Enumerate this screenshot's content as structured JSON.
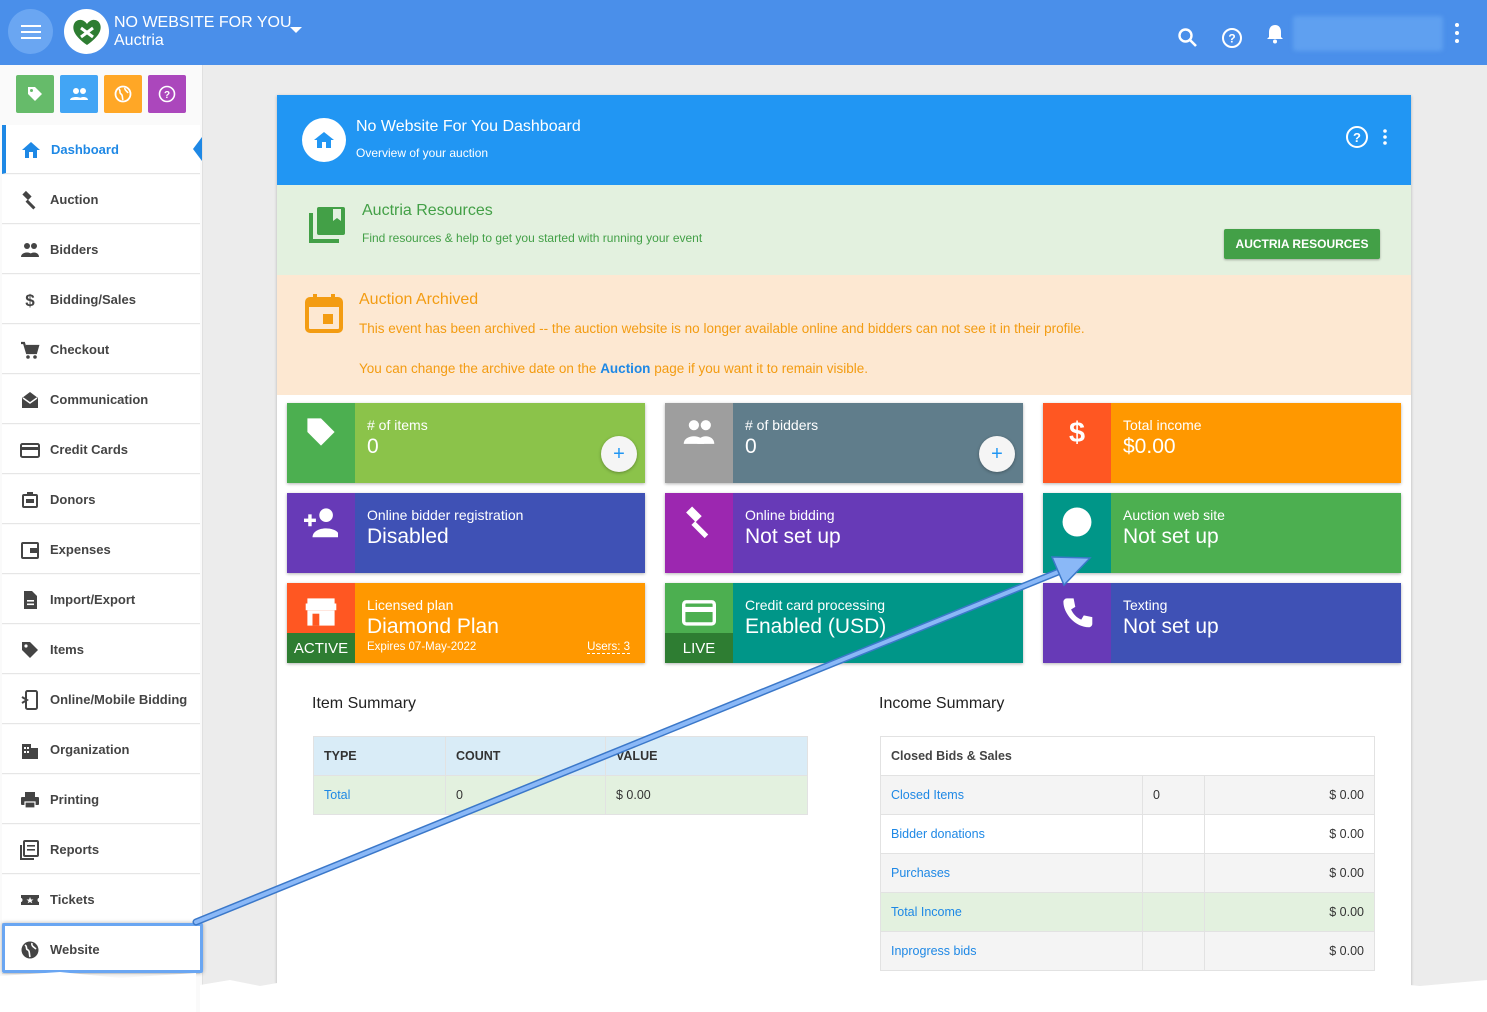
{
  "header": {
    "org_name": "NO WEBSITE FOR YOU",
    "org_sub": "Auctria"
  },
  "sidebar": {
    "quick_buttons": [
      {
        "icon": "tag-icon",
        "color": "#66bb6a"
      },
      {
        "icon": "people-icon",
        "color": "#42a5f5"
      },
      {
        "icon": "globe-icon",
        "color": "#ffa726"
      },
      {
        "icon": "help-icon",
        "color": "#ab47bc"
      }
    ],
    "items": [
      {
        "label": "Dashboard",
        "icon": "home-icon",
        "active": true
      },
      {
        "label": "Auction",
        "icon": "gavel-icon"
      },
      {
        "label": "Bidders",
        "icon": "people-icon"
      },
      {
        "label": "Bidding/Sales",
        "icon": "dollar-icon"
      },
      {
        "label": "Checkout",
        "icon": "cart-icon"
      },
      {
        "label": "Communication",
        "icon": "envelope-icon"
      },
      {
        "label": "Credit Cards",
        "icon": "credit-card-icon"
      },
      {
        "label": "Donors",
        "icon": "donors-icon"
      },
      {
        "label": "Expenses",
        "icon": "wallet-icon"
      },
      {
        "label": "Import/Export",
        "icon": "file-icon"
      },
      {
        "label": "Items",
        "icon": "tag-icon"
      },
      {
        "label": "Online/Mobile Bidding",
        "icon": "mobile-icon"
      },
      {
        "label": "Organization",
        "icon": "building-icon"
      },
      {
        "label": "Printing",
        "icon": "printer-icon"
      },
      {
        "label": "Reports",
        "icon": "reports-icon"
      },
      {
        "label": "Tickets",
        "icon": "ticket-icon"
      },
      {
        "label": "Website",
        "icon": "globe-icon"
      }
    ]
  },
  "dashboard": {
    "title": "No Website For You Dashboard",
    "subtitle": "Overview of your auction"
  },
  "resources": {
    "title": "Auctria Resources",
    "text": "Find resources & help to get you started with running your event",
    "button": "AUCTRIA RESOURCES"
  },
  "archived": {
    "title": "Auction Archived",
    "line1": "This event has been archived -- the auction website is no longer available online and bidders can not see it in their profile.",
    "line2_pre": "You can change the archive date on the ",
    "line2_link": "Auction",
    "line2_post": " page if you want it to remain visible."
  },
  "tiles": [
    {
      "label": "# of items",
      "value": "0",
      "color": "#8bc34a",
      "side": "#4caf50",
      "icon": "tag-icon"
    },
    {
      "label": "# of bidders",
      "value": "0",
      "color": "#607d8b",
      "side": "#9e9e9e",
      "icon": "people-icon"
    },
    {
      "label": "Total income",
      "value": "$0.00",
      "color": "#ff9800",
      "side": "#ff5722",
      "icon": "dollar-icon"
    },
    {
      "label": "Online bidder registration",
      "value": "Disabled",
      "color": "#3f51b5",
      "side": "#673ab7",
      "icon": "person-add-icon"
    },
    {
      "label": "Online bidding",
      "value": "Not set up",
      "color": "#673ab7",
      "side": "#9c27b0",
      "icon": "gavel-icon"
    },
    {
      "label": "Auction web site",
      "value": "Not set up",
      "color": "#4caf50",
      "side": "#009688",
      "icon": "globe-icon"
    },
    {
      "label": "Licensed plan",
      "value": "Diamond Plan",
      "color": "#ff9800",
      "side": "#ff5722",
      "icon": "store-icon",
      "badge": "ACTIVE",
      "expires": "Expires 07-May-2022",
      "users": "Users: 3"
    },
    {
      "label": "Credit card processing",
      "value": "Enabled (USD)",
      "color": "#009688",
      "side": "#4caf50",
      "icon": "credit-card-icon",
      "badge": "LIVE"
    },
    {
      "label": "Texting",
      "value": "Not set up",
      "color": "#3f51b5",
      "side": "#673ab7",
      "icon": "phone-icon"
    }
  ],
  "item_summary": {
    "title": "Item Summary",
    "columns": [
      "TYPE",
      "COUNT",
      "VALUE"
    ],
    "rows": [
      [
        "Total",
        "0",
        "$ 0.00"
      ]
    ]
  },
  "income_summary": {
    "title": "Income Summary",
    "header": "Closed Bids & Sales",
    "rows": [
      {
        "label": "Closed Items",
        "count": "0",
        "value": "$ 0.00"
      },
      {
        "label": "Bidder donations",
        "count": "",
        "value": "$ 0.00"
      },
      {
        "label": "Purchases",
        "count": "",
        "value": "$ 0.00"
      },
      {
        "label": "Total Income",
        "count": "",
        "value": "$ 0.00"
      },
      {
        "label": "Inprogress bids",
        "count": "",
        "value": "$ 0.00"
      }
    ]
  }
}
